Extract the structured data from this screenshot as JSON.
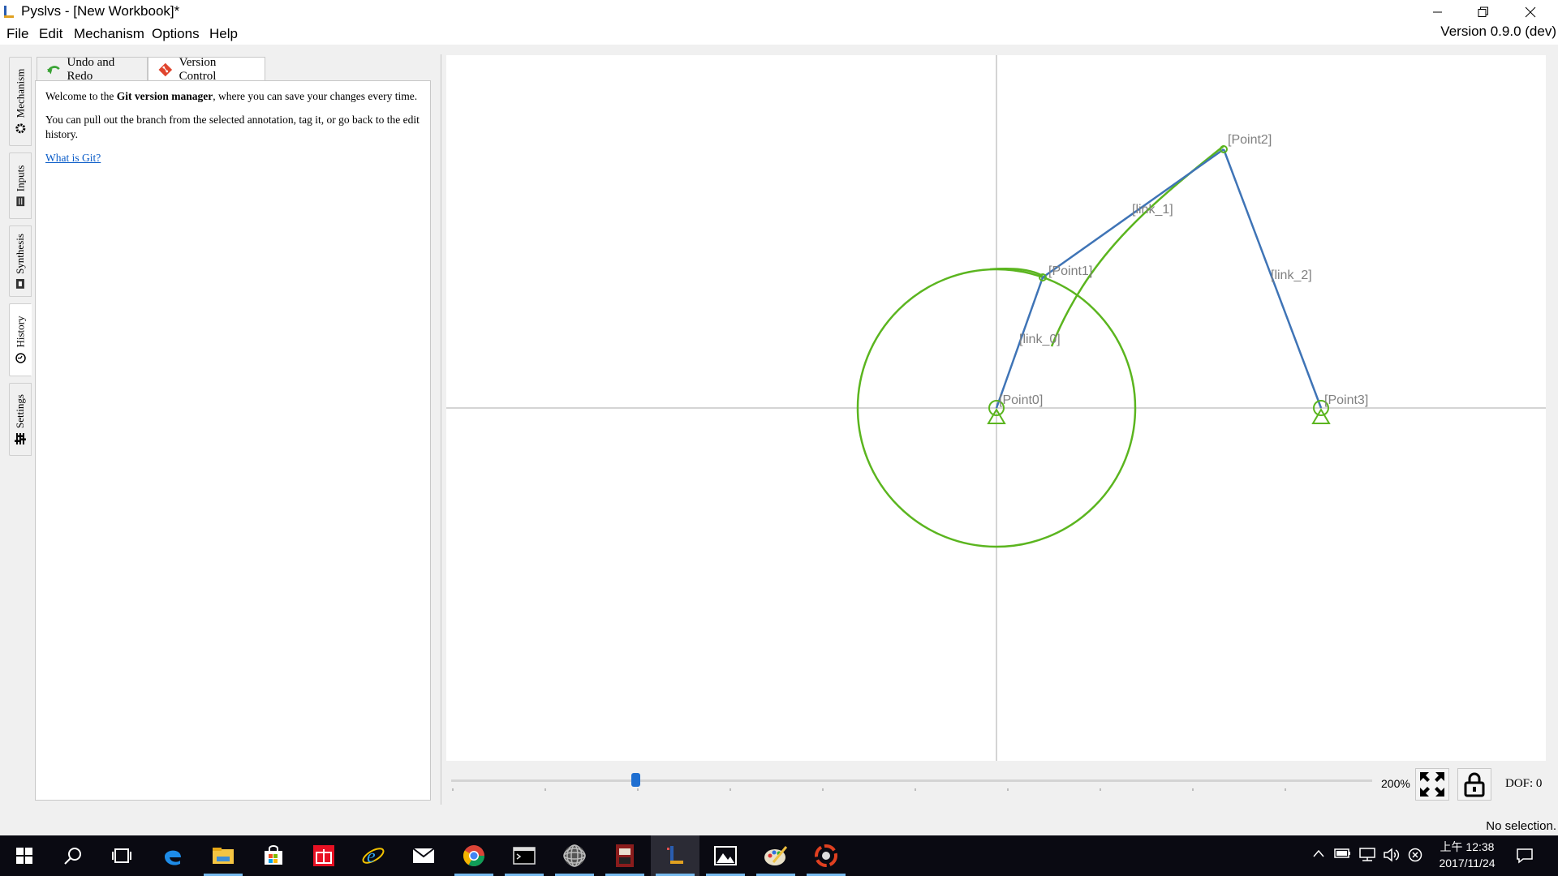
{
  "window": {
    "title": "Pyslvs - [New Workbook]*",
    "version": "Version 0.9.0 (dev)",
    "controls": {
      "minimize": "minimize-icon",
      "restore": "restore-icon",
      "close": "close-icon"
    }
  },
  "menubar": {
    "items": [
      "File",
      "Edit",
      "Mechanism",
      "Options",
      "Help"
    ]
  },
  "side_tabs": [
    {
      "label": "Mechanism",
      "icon": "gear-icon",
      "active": false
    },
    {
      "label": "Inputs",
      "icon": "inputs-icon",
      "active": false
    },
    {
      "label": "Synthesis",
      "icon": "synthesis-icon",
      "active": false
    },
    {
      "label": "History",
      "icon": "history-icon",
      "active": true
    },
    {
      "label": "Settings",
      "icon": "sliders-icon",
      "active": false
    }
  ],
  "history_panel": {
    "tabs": [
      {
        "label": "Undo and Redo",
        "icon": "undo-icon",
        "active": false
      },
      {
        "label": "Version Control",
        "icon": "git-icon",
        "active": true
      }
    ],
    "welcome_prefix": "Welcome to the ",
    "welcome_bold": "Git version manager",
    "welcome_suffix": ", where you can save your changes every time.",
    "pull_text": "You can pull out the branch from the selected annotation, tag it, or go back to the edit history.",
    "link": "What is Git?"
  },
  "canvas": {
    "points": [
      "[Point0]",
      "[Point1]",
      "[Point2]",
      "[Point3]"
    ],
    "links": [
      "[link_0]",
      "[link_1]",
      "[link_2]"
    ],
    "colors": {
      "link": "#3f74b6",
      "path": "#5bb51f",
      "axis": "#a8a8a8",
      "label": "#808080"
    }
  },
  "bottom": {
    "zoom": "200%",
    "slider_value_fraction": 0.2,
    "fit_icon": "fit-screen-icon",
    "lock_icon": "lock-icon",
    "dof": "DOF: 0"
  },
  "status": {
    "text": "No selection."
  },
  "taskbar": {
    "apps": [
      "start-icon",
      "search-icon",
      "task-view-icon",
      "edge-icon",
      "file-explorer-icon",
      "store-icon",
      "gift-icon",
      "ie-icon",
      "mail-icon",
      "chrome-icon",
      "terminal-icon",
      "sphere-app-icon",
      "game-app-icon",
      "pyslvs-icon",
      "photos-icon",
      "paint-icon",
      "camera-app-icon"
    ],
    "clock_time": "上午 12:38",
    "clock_date": "2017/11/24"
  }
}
